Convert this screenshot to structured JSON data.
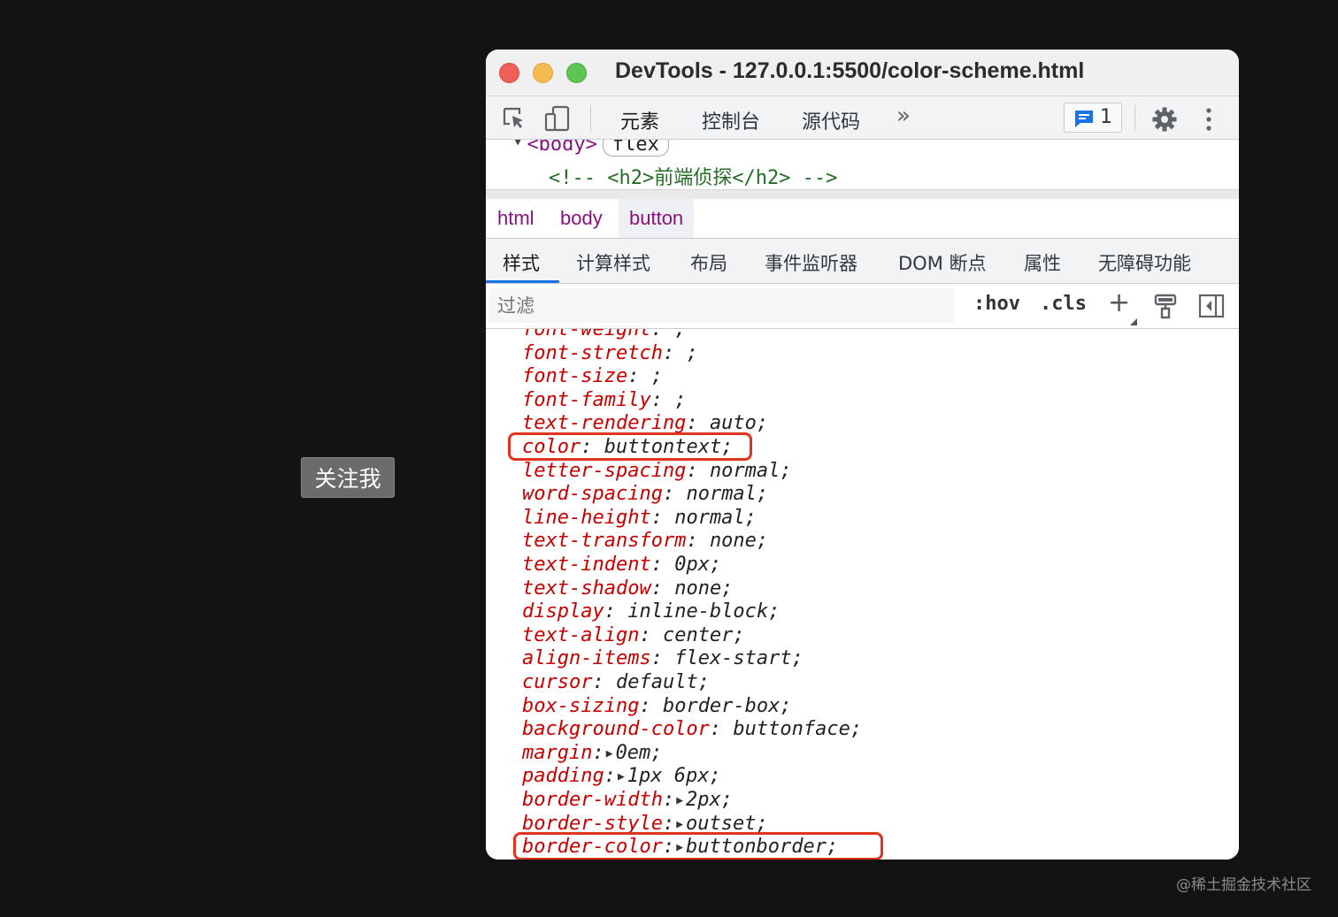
{
  "page": {
    "button_label": "关注我",
    "watermark": "@稀土掘金技术社区"
  },
  "window": {
    "title": "DevTools - 127.0.0.1:5500/color-scheme.html"
  },
  "toolbar": {
    "tabs": [
      "元素",
      "控制台",
      "源代码"
    ],
    "more": "»",
    "issues_count": "1"
  },
  "dom": {
    "line1_tag": "<body>",
    "line1_badge": "flex",
    "line2": "<!-- <h2>前端侦探</h2> -->"
  },
  "breadcrumbs": [
    "html",
    "body",
    "button"
  ],
  "subtabs": [
    "样式",
    "计算样式",
    "布局",
    "事件监听器",
    "DOM 断点",
    "属性",
    "无障碍功能"
  ],
  "filter": {
    "placeholder": "过滤",
    "hov": ":hov",
    "cls": ".cls",
    "plus": "+"
  },
  "styles": [
    {
      "name": "font-weight",
      "value": ";",
      "expand": false
    },
    {
      "name": "font-stretch",
      "value": ";",
      "expand": false
    },
    {
      "name": "font-size",
      "value": ";",
      "expand": false
    },
    {
      "name": "font-family",
      "value": ";",
      "expand": false
    },
    {
      "name": "text-rendering",
      "value": "auto;",
      "expand": false
    },
    {
      "name": "color",
      "value": "buttontext;",
      "expand": false,
      "highlighted": true
    },
    {
      "name": "letter-spacing",
      "value": "normal;",
      "expand": false
    },
    {
      "name": "word-spacing",
      "value": "normal;",
      "expand": false
    },
    {
      "name": "line-height",
      "value": "normal;",
      "expand": false
    },
    {
      "name": "text-transform",
      "value": "none;",
      "expand": false
    },
    {
      "name": "text-indent",
      "value": "0px;",
      "expand": false
    },
    {
      "name": "text-shadow",
      "value": "none;",
      "expand": false
    },
    {
      "name": "display",
      "value": "inline-block;",
      "expand": false
    },
    {
      "name": "text-align",
      "value": "center;",
      "expand": false
    },
    {
      "name": "align-items",
      "value": "flex-start;",
      "expand": false
    },
    {
      "name": "cursor",
      "value": "default;",
      "expand": false
    },
    {
      "name": "box-sizing",
      "value": "border-box;",
      "expand": false
    },
    {
      "name": "background-color",
      "value": "buttonface;",
      "expand": false
    },
    {
      "name": "margin",
      "value": "0em;",
      "expand": true
    },
    {
      "name": "padding",
      "value": "1px 6px;",
      "expand": true
    },
    {
      "name": "border-width",
      "value": "2px;",
      "expand": true
    },
    {
      "name": "border-style",
      "value": "outset;",
      "expand": true
    },
    {
      "name": "border-color",
      "value": "buttonborder;",
      "expand": true,
      "highlighted": true
    }
  ]
}
